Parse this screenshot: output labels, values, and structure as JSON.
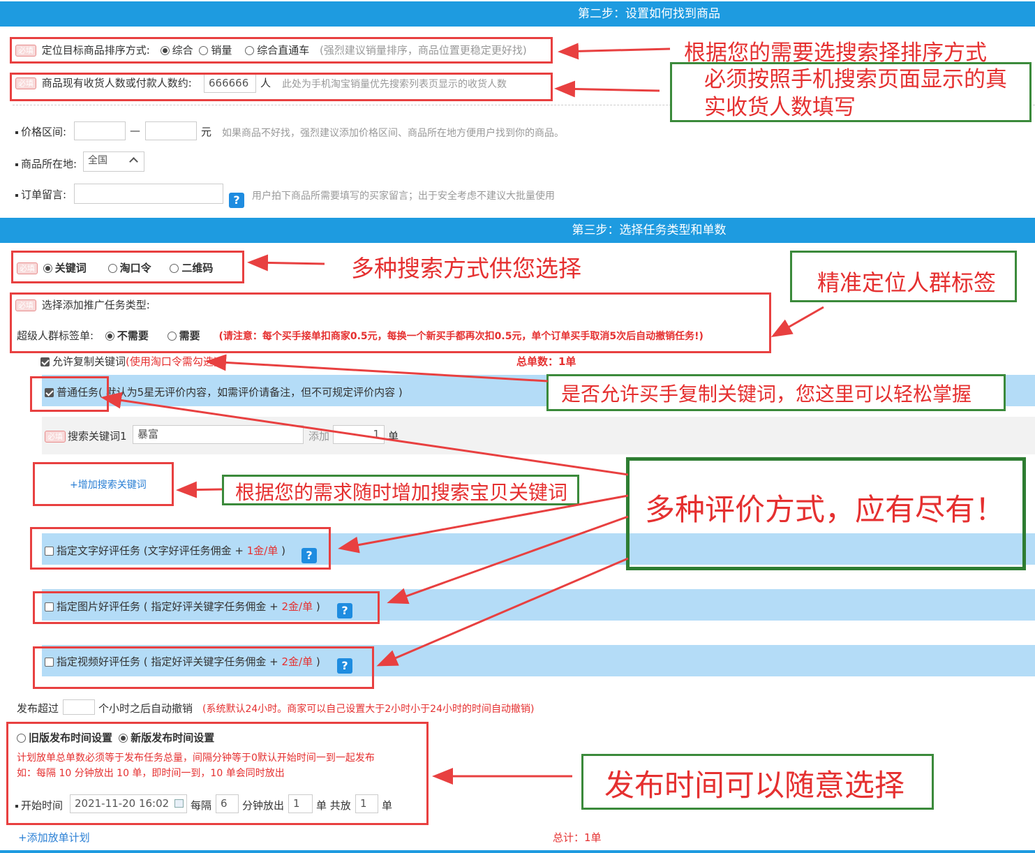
{
  "step2": {
    "title": "第二步：设置如何找到商品",
    "sort": {
      "badge": "必填",
      "label": "定位目标商品排序方式:",
      "options": [
        "综合",
        "销量",
        "综合直通车"
      ],
      "selected": "综合",
      "hint": "(强烈建议销量排序，商品位置更稳定更好找)"
    },
    "buyers": {
      "badge": "必填",
      "label": "商品现有收货人数或付款人数约:",
      "value": "666666",
      "unit": "人",
      "hint": "此处为手机淘宝销量优先搜索列表页显示的收货人数"
    },
    "price": {
      "label": "价格区间:",
      "dash": "—",
      "unit": "元",
      "hint": "如果商品不好找，强烈建议添加价格区间、商品所在地方便用户找到你的商品。"
    },
    "location": {
      "label": "商品所在地:",
      "value": "全国"
    },
    "message": {
      "label": "订单留言:",
      "hint": "用户拍下商品所需要填写的买家留言；出于安全考虑不建议大批量使用",
      "help": "?"
    }
  },
  "step3": {
    "title": "第三步：选择任务类型和单数",
    "search_type": {
      "badge": "必填",
      "options": [
        "关键词",
        "淘口令",
        "二维码"
      ],
      "selected": "关键词"
    },
    "promo": {
      "badge": "必填",
      "label": "选择添加推广任务类型:",
      "tag_label": "超级人群标签单:",
      "tag_options": [
        "不需要",
        "需要"
      ],
      "tag_selected": "不需要",
      "notice": "(请注意：每个买手接单扣商家0.5元，每换一个新买手都再次扣0.5元，单个订单买手取消5次后自动撤销任务!)"
    },
    "allow_copy": {
      "label": "允许复制关键词",
      "note": "(使用淘口令需勾选)",
      "checked": true
    },
    "total_orders": "总单数：1单",
    "normal_task": {
      "label": "普通任务( 默认为5星无评价内容，如需评价请备注，但不可规定评价内容 )",
      "checked": true
    },
    "keyword_row": {
      "badge": "必填",
      "label": "搜索关键词1",
      "keyword": "暴富",
      "add_label": "添加",
      "count": "1",
      "unit": "单"
    },
    "add_keyword": "+增加搜索关键词",
    "review_tasks": [
      {
        "label": "指定文字好评任务 (文字好评任务佣金 + ",
        "price": "1金/单",
        "close": " )",
        "help": "?"
      },
      {
        "label": "指定图片好评任务 ( 指定好评关键字任务佣金 + ",
        "price": "2金/单",
        "close": " )",
        "help": "?"
      },
      {
        "label": "指定视频好评任务 ( 指定好评关键字任务佣金 + ",
        "price": "2金/单",
        "close": " )",
        "help": "?"
      }
    ],
    "auto_cancel": {
      "prefix": "发布超过",
      "suffix": "个小时之后自动撤销",
      "note": "(系统默认24小时。商家可以自己设置大于2小时小于24小时的时间自动撤销)"
    },
    "publish": {
      "options": [
        "旧版发布时间设置",
        "新版发布时间设置"
      ],
      "selected": "新版发布时间设置",
      "rule1": "计划放单总单数必须等于发布任务总量，间隔分钟等于0默认开始时间一到一起发布",
      "rule2": "如：每隔 10 分钟放出 10 单，即时间一到，10 单会同时放出",
      "start_label": "开始时间",
      "start_value": "2021-11-20 16:02",
      "every_label": "每隔",
      "every_value": "6",
      "minutes_label": "分钟放出",
      "release_value": "1",
      "total_label": "单 共放",
      "total_value": "1",
      "unit": "单"
    },
    "add_plan": "+添加放单计划",
    "grand_total": "总计：1单"
  },
  "annotations": {
    "sort": "根据您的需要选搜索择排序方式",
    "buyers": "必须按照手机搜索页面显示的真实收货人数填写",
    "search": "多种搜索方式供您选择",
    "crowd": "精准定位人群标签",
    "copy": "是否允许买手复制关键词，您这里可以轻松掌握",
    "keyword": "根据您的需求随时增加搜索宝贝关键词",
    "review": "多种评价方式，应有尽有！",
    "time": "发布时间可以随意选择"
  },
  "colors": {
    "header": "#1e9be0",
    "row": "#b4dcf7",
    "annot_red": "#e53030",
    "annot_green": "#2e7d32",
    "help": "#1e8ce0"
  }
}
